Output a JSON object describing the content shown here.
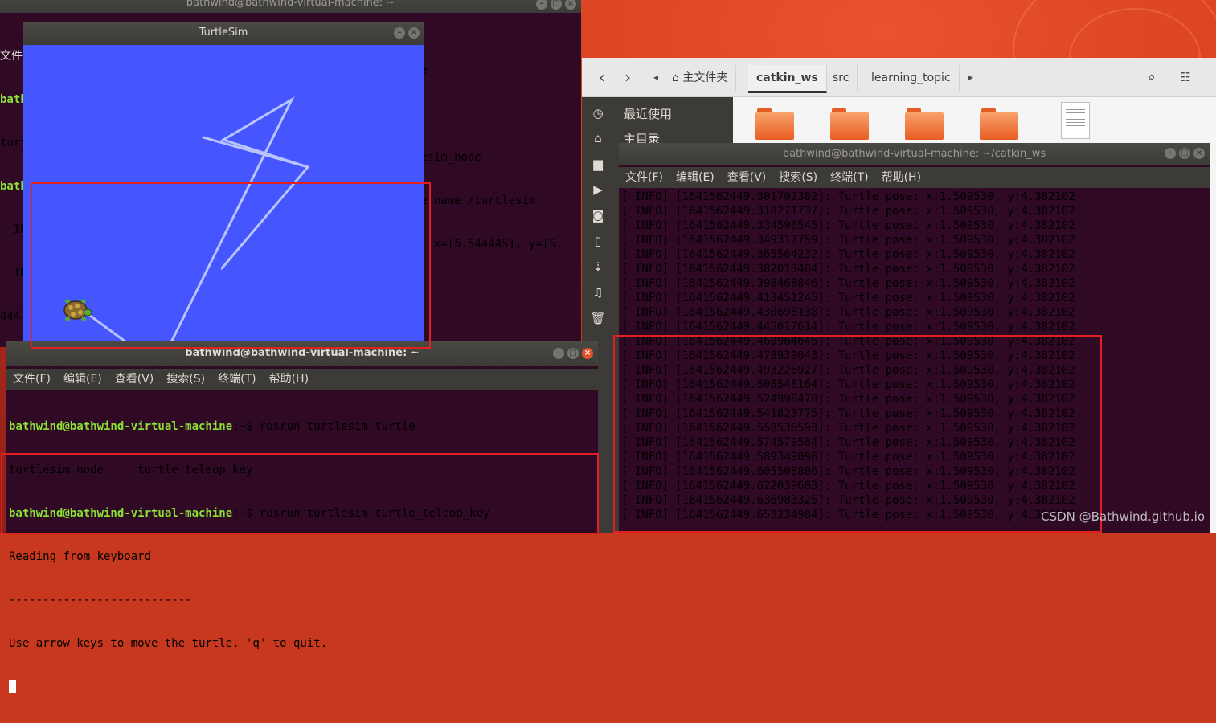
{
  "back_terminal": {
    "title": "bathwind@bathwind-virtual-machine: ~",
    "left_fragments": [
      "文件",
      "bath",
      "turt",
      "bath",
      "  IN",
      "  IN",
      "444"
    ],
    "right_fragments": [
      "e",
      "",
      "esim_node",
      "e name /turtlesim",
      ": x=[5.544445], y=[5."
    ]
  },
  "turtlesim": {
    "title": "TurtleSim",
    "background": "#4556ff",
    "trail_color": "#b8c4ff"
  },
  "file_manager": {
    "home_label": "主文件夹",
    "crumbs": [
      "catkin_ws",
      "src",
      "learning_topic"
    ],
    "sidebar": {
      "recent": "最近使用",
      "home": "主目录"
    }
  },
  "right_terminal": {
    "title": "bathwind@bathwind-virtual-machine: ~/catkin_ws",
    "menu": [
      "文件(F)",
      "编辑(E)",
      "查看(V)",
      "搜索(S)",
      "终端(T)",
      "帮助(H)"
    ],
    "lines": [
      "[ INFO] [1641562449.301702382]: Turtle pose: x:1.509530, y:4.382102",
      "[ INFO] [1641562449.318271737]: Turtle pose: x:1.509530, y:4.382102",
      "[ INFO] [1641562449.334596545]: Turtle pose: x:1.509530, y:4.382102",
      "[ INFO] [1641562449.349317759]: Turtle pose: x:1.509530, y:4.382102",
      "[ INFO] [1641562449.365564232]: Turtle pose: x:1.509530, y:4.382102",
      "[ INFO] [1641562449.382013404]: Turtle pose: x:1.509530, y:4.382102",
      "[ INFO] [1641562449.398468846]: Turtle pose: x:1.509530, y:4.382102",
      "[ INFO] [1641562449.413451245]: Turtle pose: x:1.509530, y:4.382102",
      "[ INFO] [1641562449.430698138]: Turtle pose: x:1.509530, y:4.382102",
      "[ INFO] [1641562449.445017614]: Turtle pose: x:1.509530, y:4.382102",
      "[ INFO] [1641562449.460964645]: Turtle pose: x:1.509530, y:4.382102",
      "[ INFO] [1641562449.478939043]: Turtle pose: x:1.509530, y:4.382102",
      "[ INFO] [1641562449.493226927]: Turtle pose: x:1.509530, y:4.382102",
      "[ INFO] [1641562449.508548164]: Turtle pose: x:1.509530, y:4.382102",
      "[ INFO] [1641562449.524998478]: Turtle pose: x:1.509530, y:4.382102",
      "[ INFO] [1641562449.541823775]: Turtle pose: x:1.509530, y:4.382102",
      "[ INFO] [1641562449.558536593]: Turtle pose: x:1.509530, y:4.382102",
      "[ INFO] [1641562449.574579584]: Turtle pose: x:1.509530, y:4.382102",
      "[ INFO] [1641562449.589349098]: Turtle pose: x:1.509530, y:4.382102",
      "[ INFO] [1641562449.605508806]: Turtle pose: x:1.509530, y:4.382102",
      "[ INFO] [1641562449.622039603]: Turtle pose: x:1.509530, y:4.382102",
      "[ INFO] [1641562449.636983325]: Turtle pose: x:1.509530, y:4.382102",
      "[ INFO] [1641562449.653234984]: Turtle pose: x:1.509530, y:4.382102"
    ]
  },
  "front_terminal": {
    "title": "bathwind@bathwind-virtual-machine: ~",
    "menu": [
      "文件(F)",
      "编辑(E)",
      "查看(V)",
      "搜索(S)",
      "终端(T)",
      "帮助(H)"
    ],
    "prompt": "bathwind@bathwind-virtual-machine",
    "prompt_suffix": ":~$ ",
    "cmd1": "rosrun turtlesim turtle",
    "completions": "turtlesim_node     turtle_teleop_key",
    "cmd2": "rosrun turtlesim turtle_teleop_key",
    "line_reading": "Reading from keyboard",
    "line_sep": "---------------------------",
    "line_usage": "Use arrow keys to move the turtle. 'q' to quit."
  },
  "watermark": "CSDN @Bathwind.github.io"
}
